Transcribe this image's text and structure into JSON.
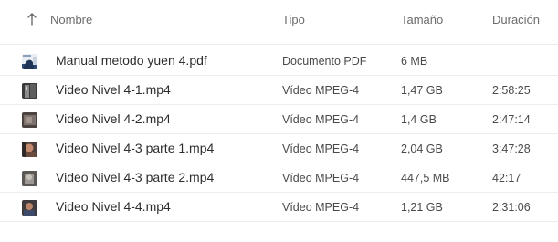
{
  "columns": {
    "name": "Nombre",
    "type": "Tipo",
    "size": "Tamaño",
    "duration": "Duración"
  },
  "sort": {
    "icon": "arrow-up-icon",
    "column": "name",
    "direction": "ascending"
  },
  "files": [
    {
      "name": "Manual metodo yuen 4.pdf",
      "type": "Documento PDF",
      "size": "6 MB",
      "duration": "",
      "thumb": "pdf-thumbnail"
    },
    {
      "name": "Video Nivel 4-1.mp4",
      "type": "Vídeo MPEG-4",
      "size": "1,47 GB",
      "duration": "2:58:25",
      "thumb": "video-thumbnail"
    },
    {
      "name": "Video Nivel 4-2.mp4",
      "type": "Vídeo MPEG-4",
      "size": "1,4 GB",
      "duration": "2:47:14",
      "thumb": "video-thumbnail"
    },
    {
      "name": "Video Nivel 4-3 parte 1.mp4",
      "type": "Vídeo MPEG-4",
      "size": "2,04 GB",
      "duration": "3:47:28",
      "thumb": "video-thumbnail"
    },
    {
      "name": "Video Nivel 4-3 parte 2.mp4",
      "type": "Vídeo MPEG-4",
      "size": "447,5 MB",
      "duration": "42:17",
      "thumb": "video-thumbnail"
    },
    {
      "name": "Video Nivel 4-4.mp4",
      "type": "Vídeo MPEG-4",
      "size": "1,21 GB",
      "duration": "2:31:06",
      "thumb": "video-thumbnail"
    }
  ]
}
